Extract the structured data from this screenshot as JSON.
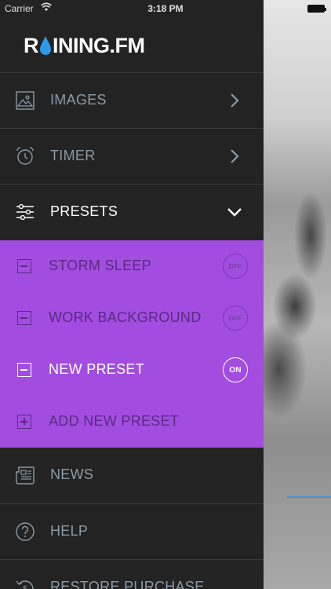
{
  "status_bar": {
    "carrier": "Carrier",
    "time": "3:18 PM"
  },
  "app": {
    "logo": "RAINING.FM",
    "logo_prefix": "R",
    "logo_suffix": "INING.FM"
  },
  "menu": {
    "images": {
      "label": "IMAGES",
      "icon": "image-icon"
    },
    "timer": {
      "label": "TIMER",
      "icon": "alarm-clock-icon"
    },
    "presets": {
      "label": "PRESETS",
      "icon": "sliders-icon"
    },
    "news": {
      "label": "NEWS",
      "icon": "newspaper-icon"
    },
    "help": {
      "label": "HELP",
      "icon": "help-icon"
    },
    "restore": {
      "label": "RESTORE PURCHASE",
      "icon": "restore-icon"
    }
  },
  "presets": [
    {
      "label": "STORM SLEEP",
      "toggle": "OFF"
    },
    {
      "label": "WORK BACKGROUND",
      "toggle": "OFF"
    },
    {
      "label": "NEW PRESET",
      "toggle": "ON"
    },
    {
      "label": "ADD NEW PRESET"
    }
  ],
  "colors": {
    "drawer_bg": "#232323",
    "accent_purple": "#a24ddf",
    "menu_text": "#8b9aa6"
  }
}
